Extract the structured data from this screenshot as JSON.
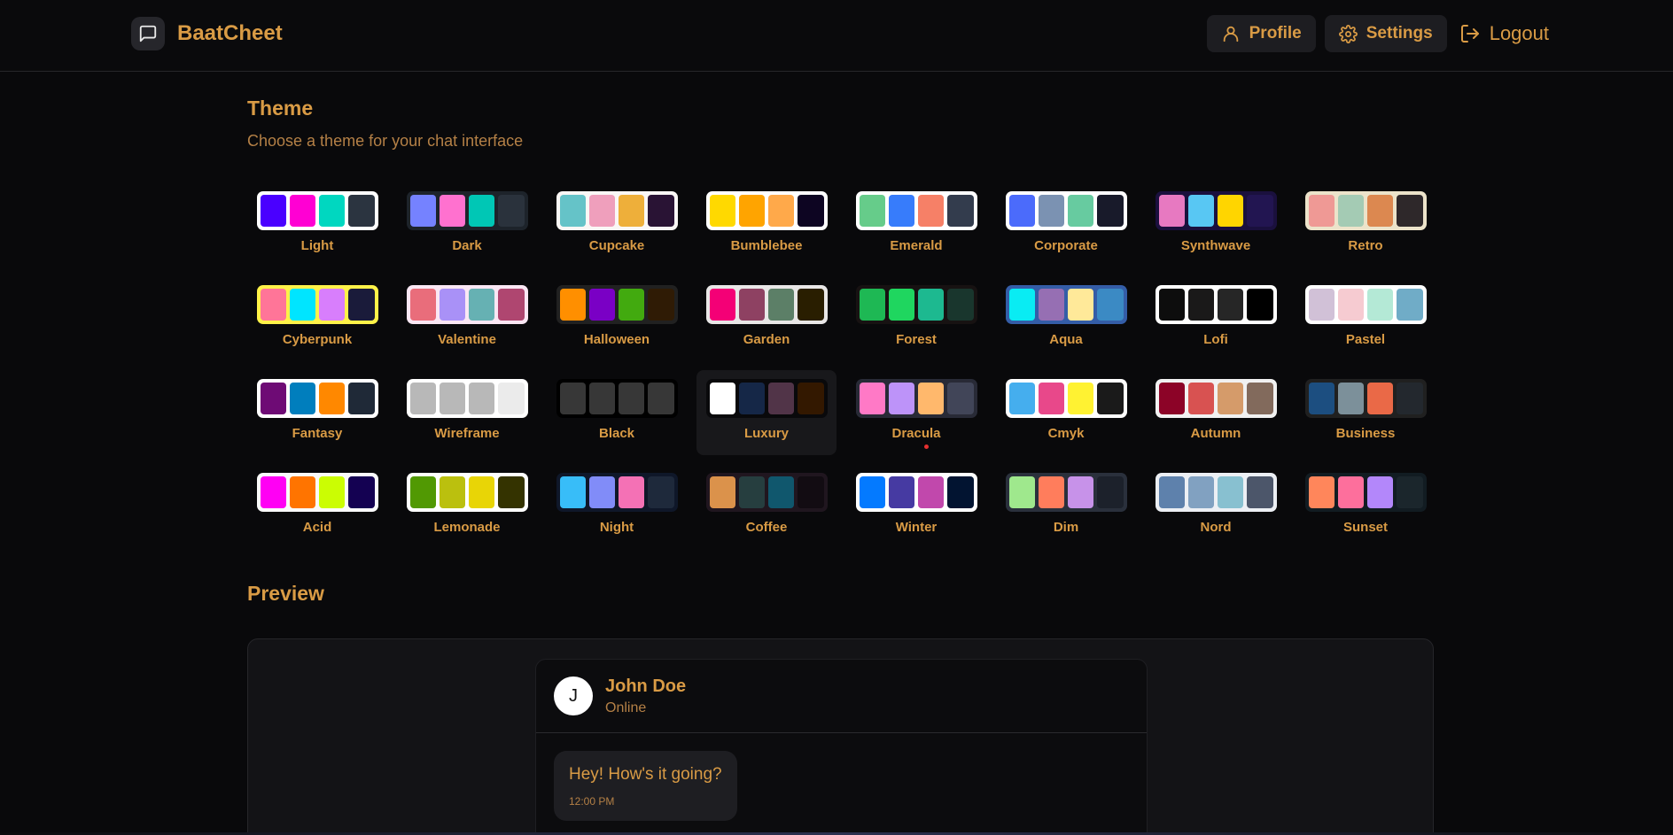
{
  "app": {
    "name": "BaatCheet"
  },
  "nav": {
    "profile": "Profile",
    "settings": "Settings",
    "logout": "Logout"
  },
  "theme": {
    "title": "Theme",
    "subtitle": "Choose a theme for your chat interface",
    "active": "Luxury",
    "items": [
      {
        "name": "Light",
        "bg": "#ffffff",
        "colors": [
          "#4a00ff",
          "#ff00d3",
          "#00d7c0",
          "#2b3440"
        ]
      },
      {
        "name": "Dark",
        "bg": "#1d232a",
        "colors": [
          "#7582ff",
          "#ff71cf",
          "#00c7b5",
          "#2a323c"
        ]
      },
      {
        "name": "Cupcake",
        "bg": "#faf7f5",
        "colors": [
          "#65c3c8",
          "#ef9fbc",
          "#eeaf3a",
          "#291334"
        ]
      },
      {
        "name": "Bumblebee",
        "bg": "#ffffff",
        "colors": [
          "#ffd900",
          "#ffa400",
          "#ffa94a",
          "#0d0522"
        ]
      },
      {
        "name": "Emerald",
        "bg": "#ffffff",
        "colors": [
          "#66cc8a",
          "#377cfb",
          "#f68067",
          "#333c4d"
        ]
      },
      {
        "name": "Corporate",
        "bg": "#ffffff",
        "colors": [
          "#4b6bfb",
          "#7b92b2",
          "#67cba0",
          "#181a2a"
        ]
      },
      {
        "name": "Synthwave",
        "bg": "#1a103d",
        "colors": [
          "#e779c1",
          "#58c7f3",
          "#ffd500",
          "#221551"
        ]
      },
      {
        "name": "Retro",
        "bg": "#ece3ca",
        "colors": [
          "#ef9995",
          "#a4cbb4",
          "#dc8850",
          "#2e282a"
        ]
      },
      {
        "name": "Cyberpunk",
        "bg": "#fff248",
        "colors": [
          "#ff7598",
          "#00e5ff",
          "#d87efc",
          "#1a1b3a"
        ]
      },
      {
        "name": "Valentine",
        "bg": "#fae7f4",
        "colors": [
          "#e96d7b",
          "#a991f7",
          "#66b1b3",
          "#af4670"
        ]
      },
      {
        "name": "Halloween",
        "bg": "#212121",
        "colors": [
          "#ff8f00",
          "#7a00c5",
          "#42aa0f",
          "#2f1b05"
        ]
      },
      {
        "name": "Garden",
        "bg": "#e9e7e7",
        "colors": [
          "#f40076",
          "#8e4162",
          "#5c7f67",
          "#291e00"
        ]
      },
      {
        "name": "Forest",
        "bg": "#171212",
        "colors": [
          "#1eb854",
          "#1fd65f",
          "#1db990",
          "#19362d"
        ]
      },
      {
        "name": "Aqua",
        "bg": "#345da7",
        "colors": [
          "#09ecf3",
          "#966fb3",
          "#ffe999",
          "#3b8ac4"
        ]
      },
      {
        "name": "Lofi",
        "bg": "#ffffff",
        "colors": [
          "#0d0d0d",
          "#1a1919",
          "#262626",
          "#000000"
        ]
      },
      {
        "name": "Pastel",
        "bg": "#ffffff",
        "colors": [
          "#d1c1d7",
          "#f6cbd1",
          "#b4e9d6",
          "#70acc7"
        ]
      },
      {
        "name": "Fantasy",
        "bg": "#ffffff",
        "colors": [
          "#6e0b75",
          "#007ebd",
          "#ff8800",
          "#1f2937"
        ]
      },
      {
        "name": "Wireframe",
        "bg": "#ffffff",
        "colors": [
          "#b8b8b8",
          "#b8b8b8",
          "#b8b8b8",
          "#ebebeb"
        ]
      },
      {
        "name": "Black",
        "bg": "#000000",
        "colors": [
          "#373737",
          "#373737",
          "#373737",
          "#373737"
        ]
      },
      {
        "name": "Luxury",
        "bg": "#09090b",
        "colors": [
          "#ffffff",
          "#152747",
          "#513448",
          "#331800"
        ]
      },
      {
        "name": "Dracula",
        "bg": "#282a36",
        "colors": [
          "#ff79c6",
          "#bd93f9",
          "#ffb86c",
          "#414558"
        ]
      },
      {
        "name": "Cmyk",
        "bg": "#ffffff",
        "colors": [
          "#45aeee",
          "#e8488a",
          "#fff232",
          "#1a1a1a"
        ]
      },
      {
        "name": "Autumn",
        "bg": "#f1f1f1",
        "colors": [
          "#8c0327",
          "#d85251",
          "#d59b6a",
          "#826a5c"
        ]
      },
      {
        "name": "Business",
        "bg": "#202020",
        "colors": [
          "#1c4e80",
          "#7c909a",
          "#ea6947",
          "#23282e"
        ]
      },
      {
        "name": "Acid",
        "bg": "#fafafa",
        "colors": [
          "#ff00f4",
          "#ff7400",
          "#cbfd03",
          "#140152"
        ]
      },
      {
        "name": "Lemonade",
        "bg": "#ffffff",
        "colors": [
          "#519903",
          "#bbc00e",
          "#e8d506",
          "#343300"
        ]
      },
      {
        "name": "Night",
        "bg": "#0f1729",
        "colors": [
          "#38bdf8",
          "#818cf8",
          "#f471b5",
          "#1e293b"
        ]
      },
      {
        "name": "Coffee",
        "bg": "#20161f",
        "colors": [
          "#db924b",
          "#263e3f",
          "#10576d",
          "#120c12"
        ]
      },
      {
        "name": "Winter",
        "bg": "#ffffff",
        "colors": [
          "#047aff",
          "#463aa2",
          "#c148ac",
          "#021431"
        ]
      },
      {
        "name": "Dim",
        "bg": "#2a303c",
        "colors": [
          "#9fe88d",
          "#ff7d5c",
          "#c792e9",
          "#1c212b"
        ]
      },
      {
        "name": "Nord",
        "bg": "#eceff4",
        "colors": [
          "#5e81ac",
          "#81a1c1",
          "#88c0d0",
          "#4c566a"
        ]
      },
      {
        "name": "Sunset",
        "bg": "#121c22",
        "colors": [
          "#ff865b",
          "#fd6f9c",
          "#b387fa",
          "#1b262c"
        ]
      }
    ]
  },
  "preview": {
    "title": "Preview",
    "contact": {
      "initial": "J",
      "name": "John Doe",
      "status": "Online"
    },
    "message": {
      "text": "Hey! How's it going?",
      "time": "12:00 PM"
    }
  },
  "colors": {
    "accent": "#d99b45",
    "background": "#09090b"
  }
}
